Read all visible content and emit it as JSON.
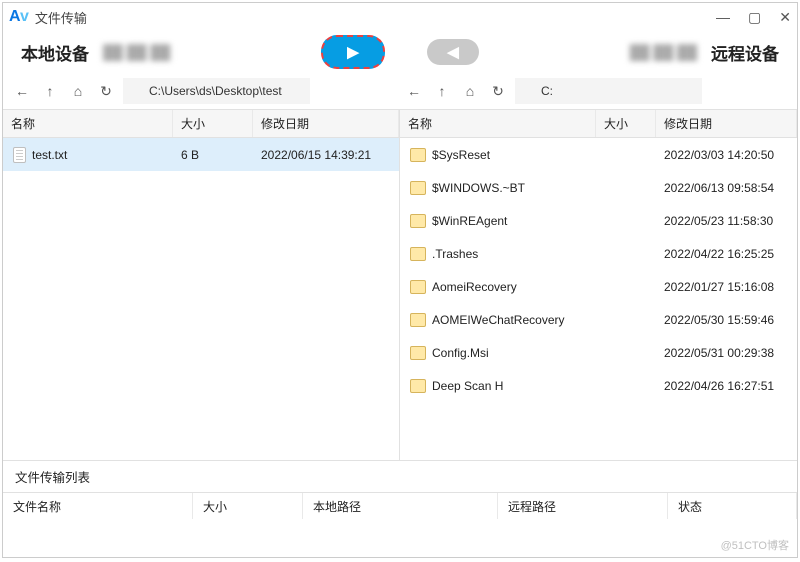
{
  "window": {
    "title": "文件传输"
  },
  "devbar": {
    "local": "本地设备",
    "remote": "远程设备"
  },
  "nav": {
    "local_path": "C:\\Users\\ds\\Desktop\\test",
    "remote_path": "C:"
  },
  "columns": {
    "name": "名称",
    "size": "大小",
    "date": "修改日期"
  },
  "local_files": [
    {
      "icon": "file",
      "name": "test.txt",
      "size": "6 B",
      "date": "2022/06/15 14:39:21",
      "selected": true
    }
  ],
  "remote_files": [
    {
      "icon": "fold",
      "name": "$SysReset",
      "date": "2022/03/03 14:20:50"
    },
    {
      "icon": "fold",
      "name": "$WINDOWS.~BT",
      "date": "2022/06/13 09:58:54"
    },
    {
      "icon": "fold",
      "name": "$WinREAgent",
      "date": "2022/05/23 11:58:30"
    },
    {
      "icon": "fold",
      "name": ".Trashes",
      "date": "2022/04/22 16:25:25"
    },
    {
      "icon": "fold",
      "name": "AomeiRecovery",
      "date": "2022/01/27 15:16:08"
    },
    {
      "icon": "fold",
      "name": "AOMEIWeChatRecovery",
      "date": "2022/05/30 15:59:46"
    },
    {
      "icon": "fold",
      "name": "Config.Msi",
      "date": "2022/05/31 00:29:38"
    },
    {
      "icon": "fold",
      "name": "Deep Scan H",
      "date": "2022/04/26 16:27:51"
    }
  ],
  "queue": {
    "title": "文件传输列表",
    "cols": {
      "name": "文件名称",
      "size": "大小",
      "local": "本地路径",
      "remote": "远程路径",
      "status": "状态"
    }
  },
  "watermark": "@51CTO博客"
}
